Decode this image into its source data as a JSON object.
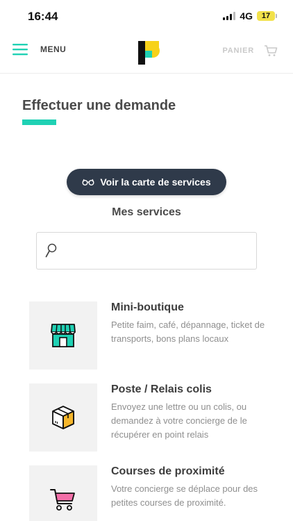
{
  "status_bar": {
    "time": "16:44",
    "network": "4G",
    "battery": "17"
  },
  "header": {
    "menu_label": "MENU",
    "cart_label": "PANIER"
  },
  "page": {
    "title": "Effectuer une demande"
  },
  "map_button": {
    "label": "Voir la carte de services",
    "icon": "glasses-icon"
  },
  "services_section": {
    "title": "Mes services"
  },
  "search": {
    "value": "",
    "placeholder": ""
  },
  "services": [
    {
      "title": "Mini-boutique",
      "description": "Petite faim, café, dépannage, ticket de transports, bons plans locaux",
      "icon": "shop-icon"
    },
    {
      "title": "Poste / Relais colis",
      "description": "Envoyez une lettre ou un colis, ou demandez à votre concierge de le récupérer en point relais",
      "icon": "package-icon"
    },
    {
      "title": "Courses de proximité",
      "description": "Votre concierge se déplace pour des petites courses de proximité.",
      "icon": "shopping-cart-icon"
    }
  ],
  "colors": {
    "accent": "#1fd1b4",
    "brand_yellow": "#f7d21a",
    "button_dark": "#2f3a4a",
    "package_orange": "#f5b62b",
    "cart_pink": "#f26fa8"
  }
}
